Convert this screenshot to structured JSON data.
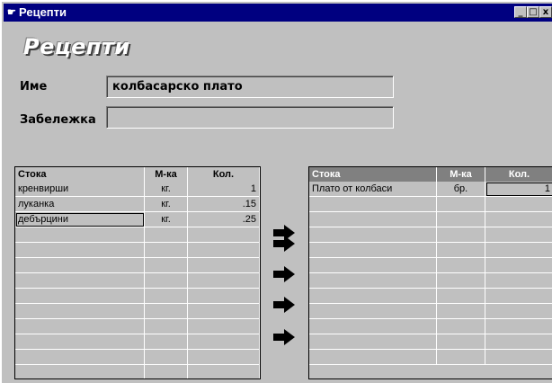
{
  "window": {
    "title": "Рецепти",
    "minimize": "_",
    "maximize": "□",
    "close": "x"
  },
  "heading": "Рецепти",
  "form": {
    "name_label": "Име",
    "name_value": "колбасарско плато",
    "note_label": "Забележка",
    "note_value": ""
  },
  "left_grid": {
    "headers": [
      "Стока",
      "М-ка",
      "Кол."
    ],
    "rows": [
      [
        "кренвирши",
        "кг.",
        "1"
      ],
      [
        "луканка",
        "кг.",
        ".15"
      ],
      [
        "дебърцини",
        "кг.",
        ".25"
      ]
    ]
  },
  "right_grid": {
    "headers": [
      "Стока",
      "М-ка",
      "Кол."
    ],
    "rows": [
      [
        "Плато от колбаси",
        "бр.",
        "1"
      ]
    ]
  },
  "arrows": [
    "arrow-right-icon",
    "arrow-right-icon",
    "arrow-right-icon",
    "arrow-right-icon",
    "arrow-right-icon"
  ],
  "colors": {
    "title_bar": "#000080",
    "grid_header": "#808080",
    "window": "#c0c0c0"
  }
}
